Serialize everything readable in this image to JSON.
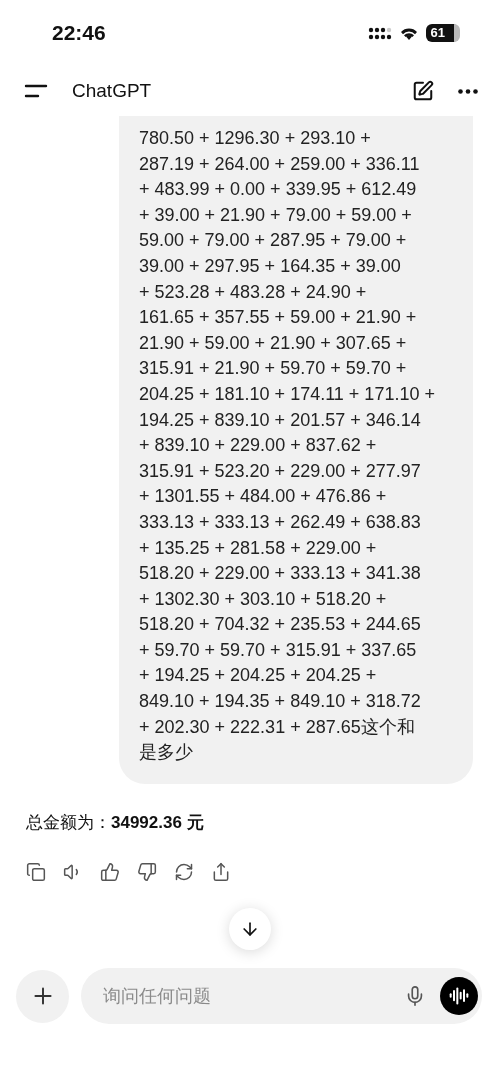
{
  "status_bar": {
    "time": "22:46",
    "battery": "61"
  },
  "header": {
    "title": "ChatGPT"
  },
  "message": {
    "lines": [
      "780.50 + 1296.30 + 293.10 +",
      "287.19 + 264.00 + 259.00 + 336.11",
      "+ 483.99 + 0.00 + 339.95 + 612.49",
      "+ 39.00 + 21.90 + 79.00 + 59.00 +",
      "59.00 + 79.00 + 287.95 + 79.00 +",
      "39.00 + 297.95 + 164.35 + 39.00",
      "+ 523.28 + 483.28 + 24.90 +",
      "161.65 + 357.55 + 59.00 + 21.90 +",
      "21.90 + 59.00 + 21.90 + 307.65 +",
      "315.91 + 21.90 + 59.70 + 59.70 +",
      "204.25 + 181.10 + 174.11 + 171.10 +",
      "194.25 + 839.10 + 201.57 + 346.14",
      "+ 839.10 + 229.00 + 837.62 +",
      "315.91 + 523.20 + 229.00 + 277.97",
      "+ 1301.55 + 484.00 + 476.86 +",
      "333.13 + 333.13 + 262.49 + 638.83",
      "+ 135.25 + 281.58 + 229.00 +",
      "518.20 + 229.00 + 333.13 + 341.38",
      "+ 1302.30 + 303.10 + 518.20 +",
      "518.20 + 704.32 + 235.53 + 244.65",
      "+ 59.70 + 59.70 + 315.91 + 337.65",
      "+ 194.25 + 204.25 + 204.25 +",
      "849.10 + 194.35 + 849.10 + 318.72",
      "+ 202.30 + 222.31 + 287.65这个和",
      "是多少"
    ]
  },
  "answer": "总金额为：**34992.36 元**",
  "actions": [
    {
      "kind": "copy"
    },
    {
      "kind": "speak"
    },
    {
      "kind": "like"
    },
    {
      "kind": "dislike"
    },
    {
      "kind": "regenerate"
    },
    {
      "kind": "share"
    }
  ],
  "composer": {
    "placeholder": "询问任何问题"
  }
}
